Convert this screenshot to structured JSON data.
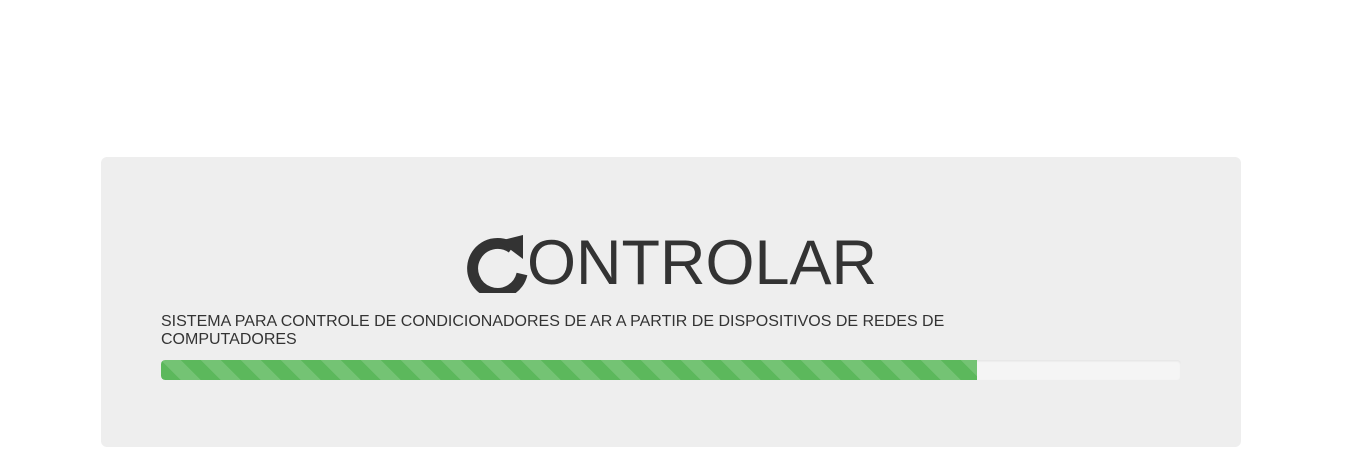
{
  "header": {
    "brand_icon": "refresh-icon",
    "brand_text": "ONTROLAR",
    "subtitle": "SISTEMA PARA CONTROLE DE CONDICIONADORES DE AR A PARTIR DE DISPOSITIVOS DE REDES DE COMPUTADORES"
  },
  "progress": {
    "value_percent": 80,
    "color": "#5cb85c",
    "track_color": "#f5f5f5",
    "striped": true
  },
  "colors": {
    "panel_background": "#eeeeee",
    "text": "#333333"
  }
}
